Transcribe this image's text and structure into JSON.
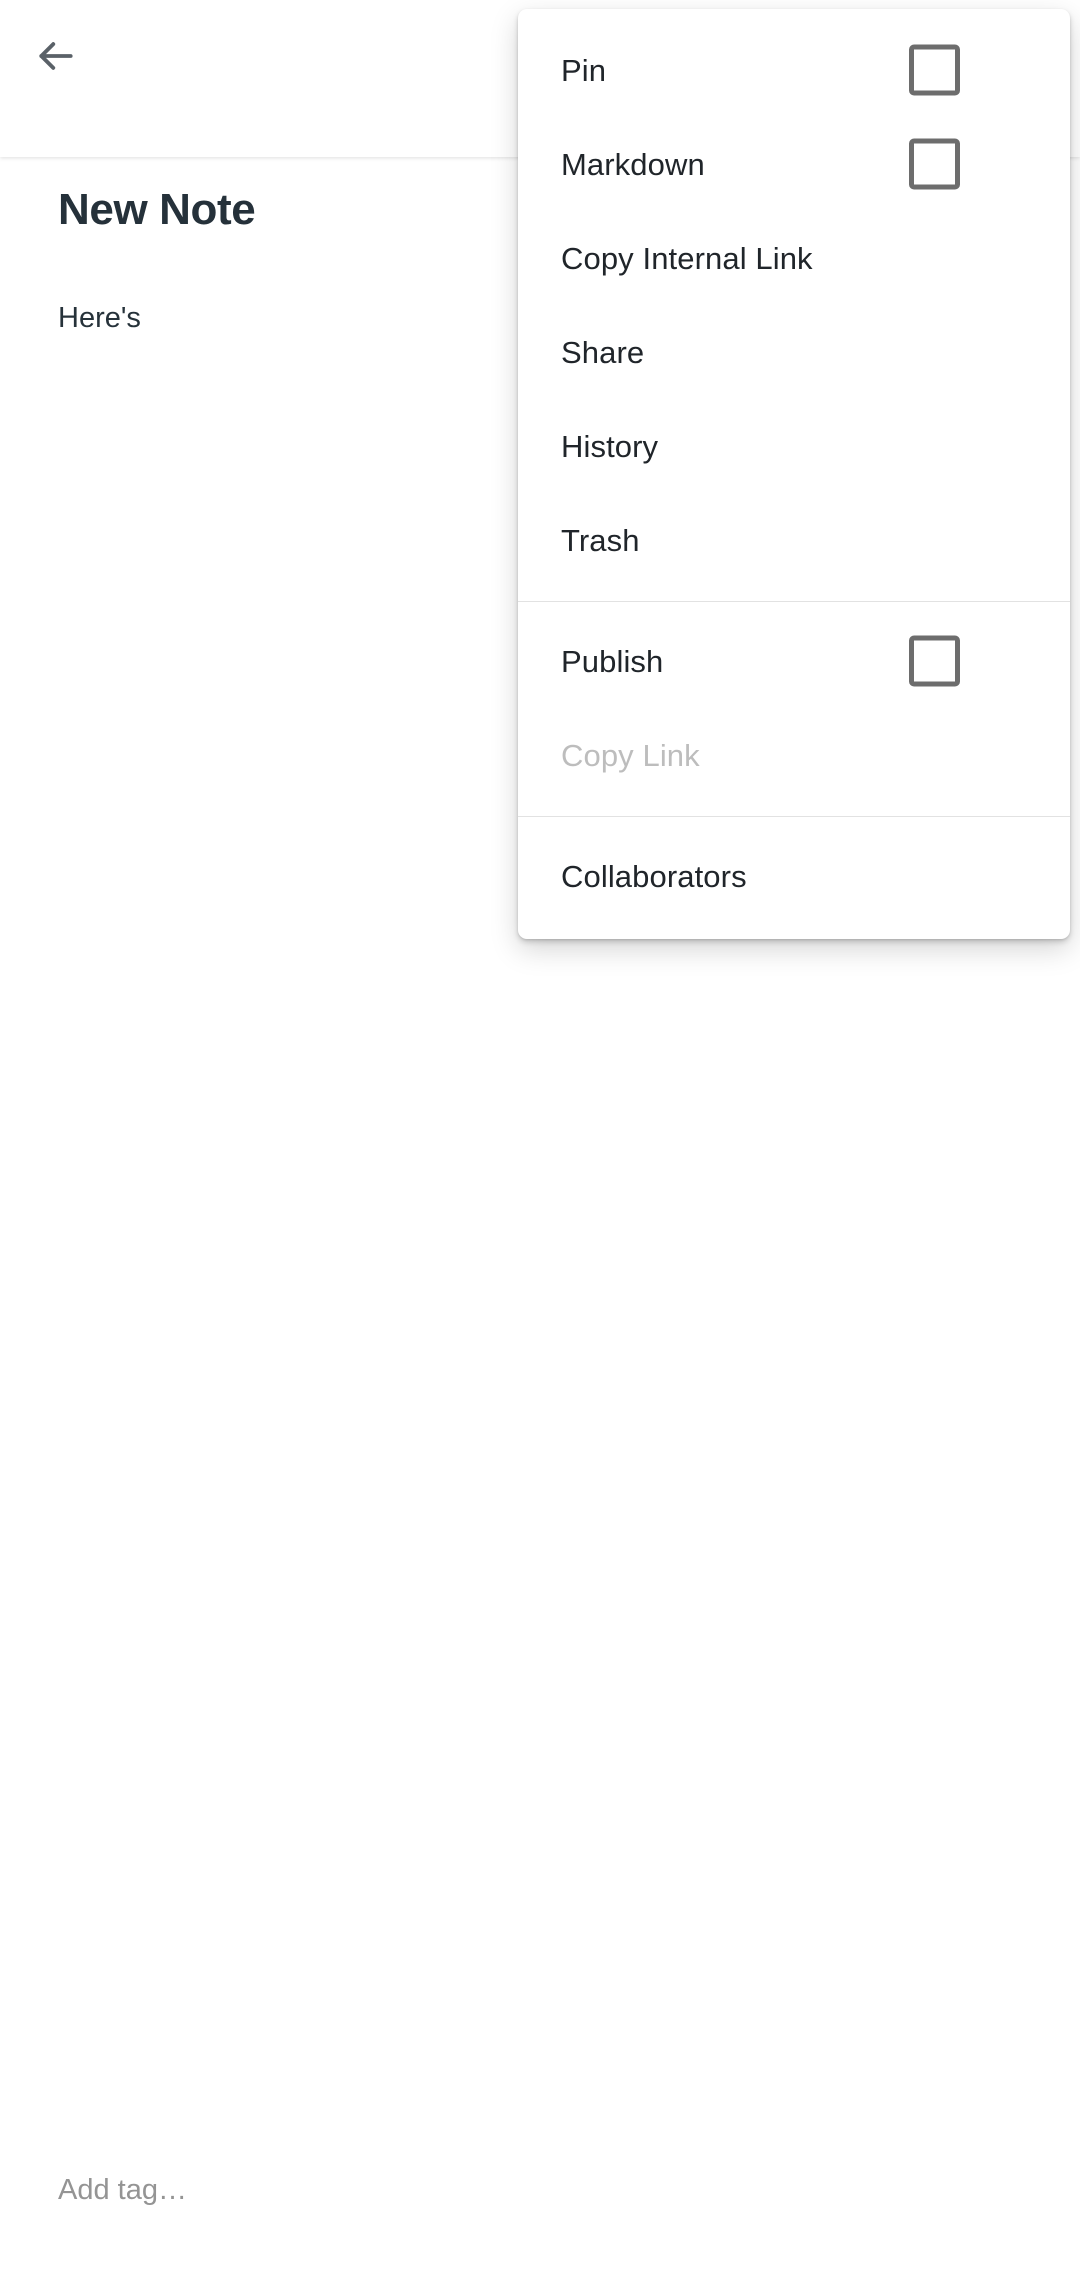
{
  "appbar": {
    "back_icon": "arrow-left-icon",
    "back_label": "Back"
  },
  "note": {
    "title": "New Note",
    "body": "Here's"
  },
  "tags": {
    "placeholder": "Add tag…",
    "value": ""
  },
  "menu": {
    "groups": [
      {
        "items": [
          {
            "label": "Pin",
            "type": "checkbox",
            "checked": false,
            "disabled": false
          },
          {
            "label": "Markdown",
            "type": "checkbox",
            "checked": false,
            "disabled": false
          },
          {
            "label": "Copy Internal Link",
            "type": "action",
            "checked": false,
            "disabled": false
          },
          {
            "label": "Share",
            "type": "action",
            "checked": false,
            "disabled": false
          },
          {
            "label": "History",
            "type": "action",
            "checked": false,
            "disabled": false
          },
          {
            "label": "Trash",
            "type": "action",
            "checked": false,
            "disabled": false
          }
        ]
      },
      {
        "items": [
          {
            "label": "Publish",
            "type": "checkbox",
            "checked": false,
            "disabled": false
          },
          {
            "label": "Copy Link",
            "type": "action",
            "checked": false,
            "disabled": true
          }
        ]
      },
      {
        "items": [
          {
            "label": "Collaborators",
            "type": "action",
            "checked": false,
            "disabled": false
          }
        ]
      }
    ]
  },
  "colors": {
    "surface": "#ffffff",
    "text_primary": "#20252a",
    "text_title": "#25313a",
    "text_disabled": "#bdbdbd",
    "text_placeholder": "#949494",
    "icon": "#5a6168",
    "divider": "#e2e2e2",
    "checkbox_border": "#6d6d6d"
  }
}
